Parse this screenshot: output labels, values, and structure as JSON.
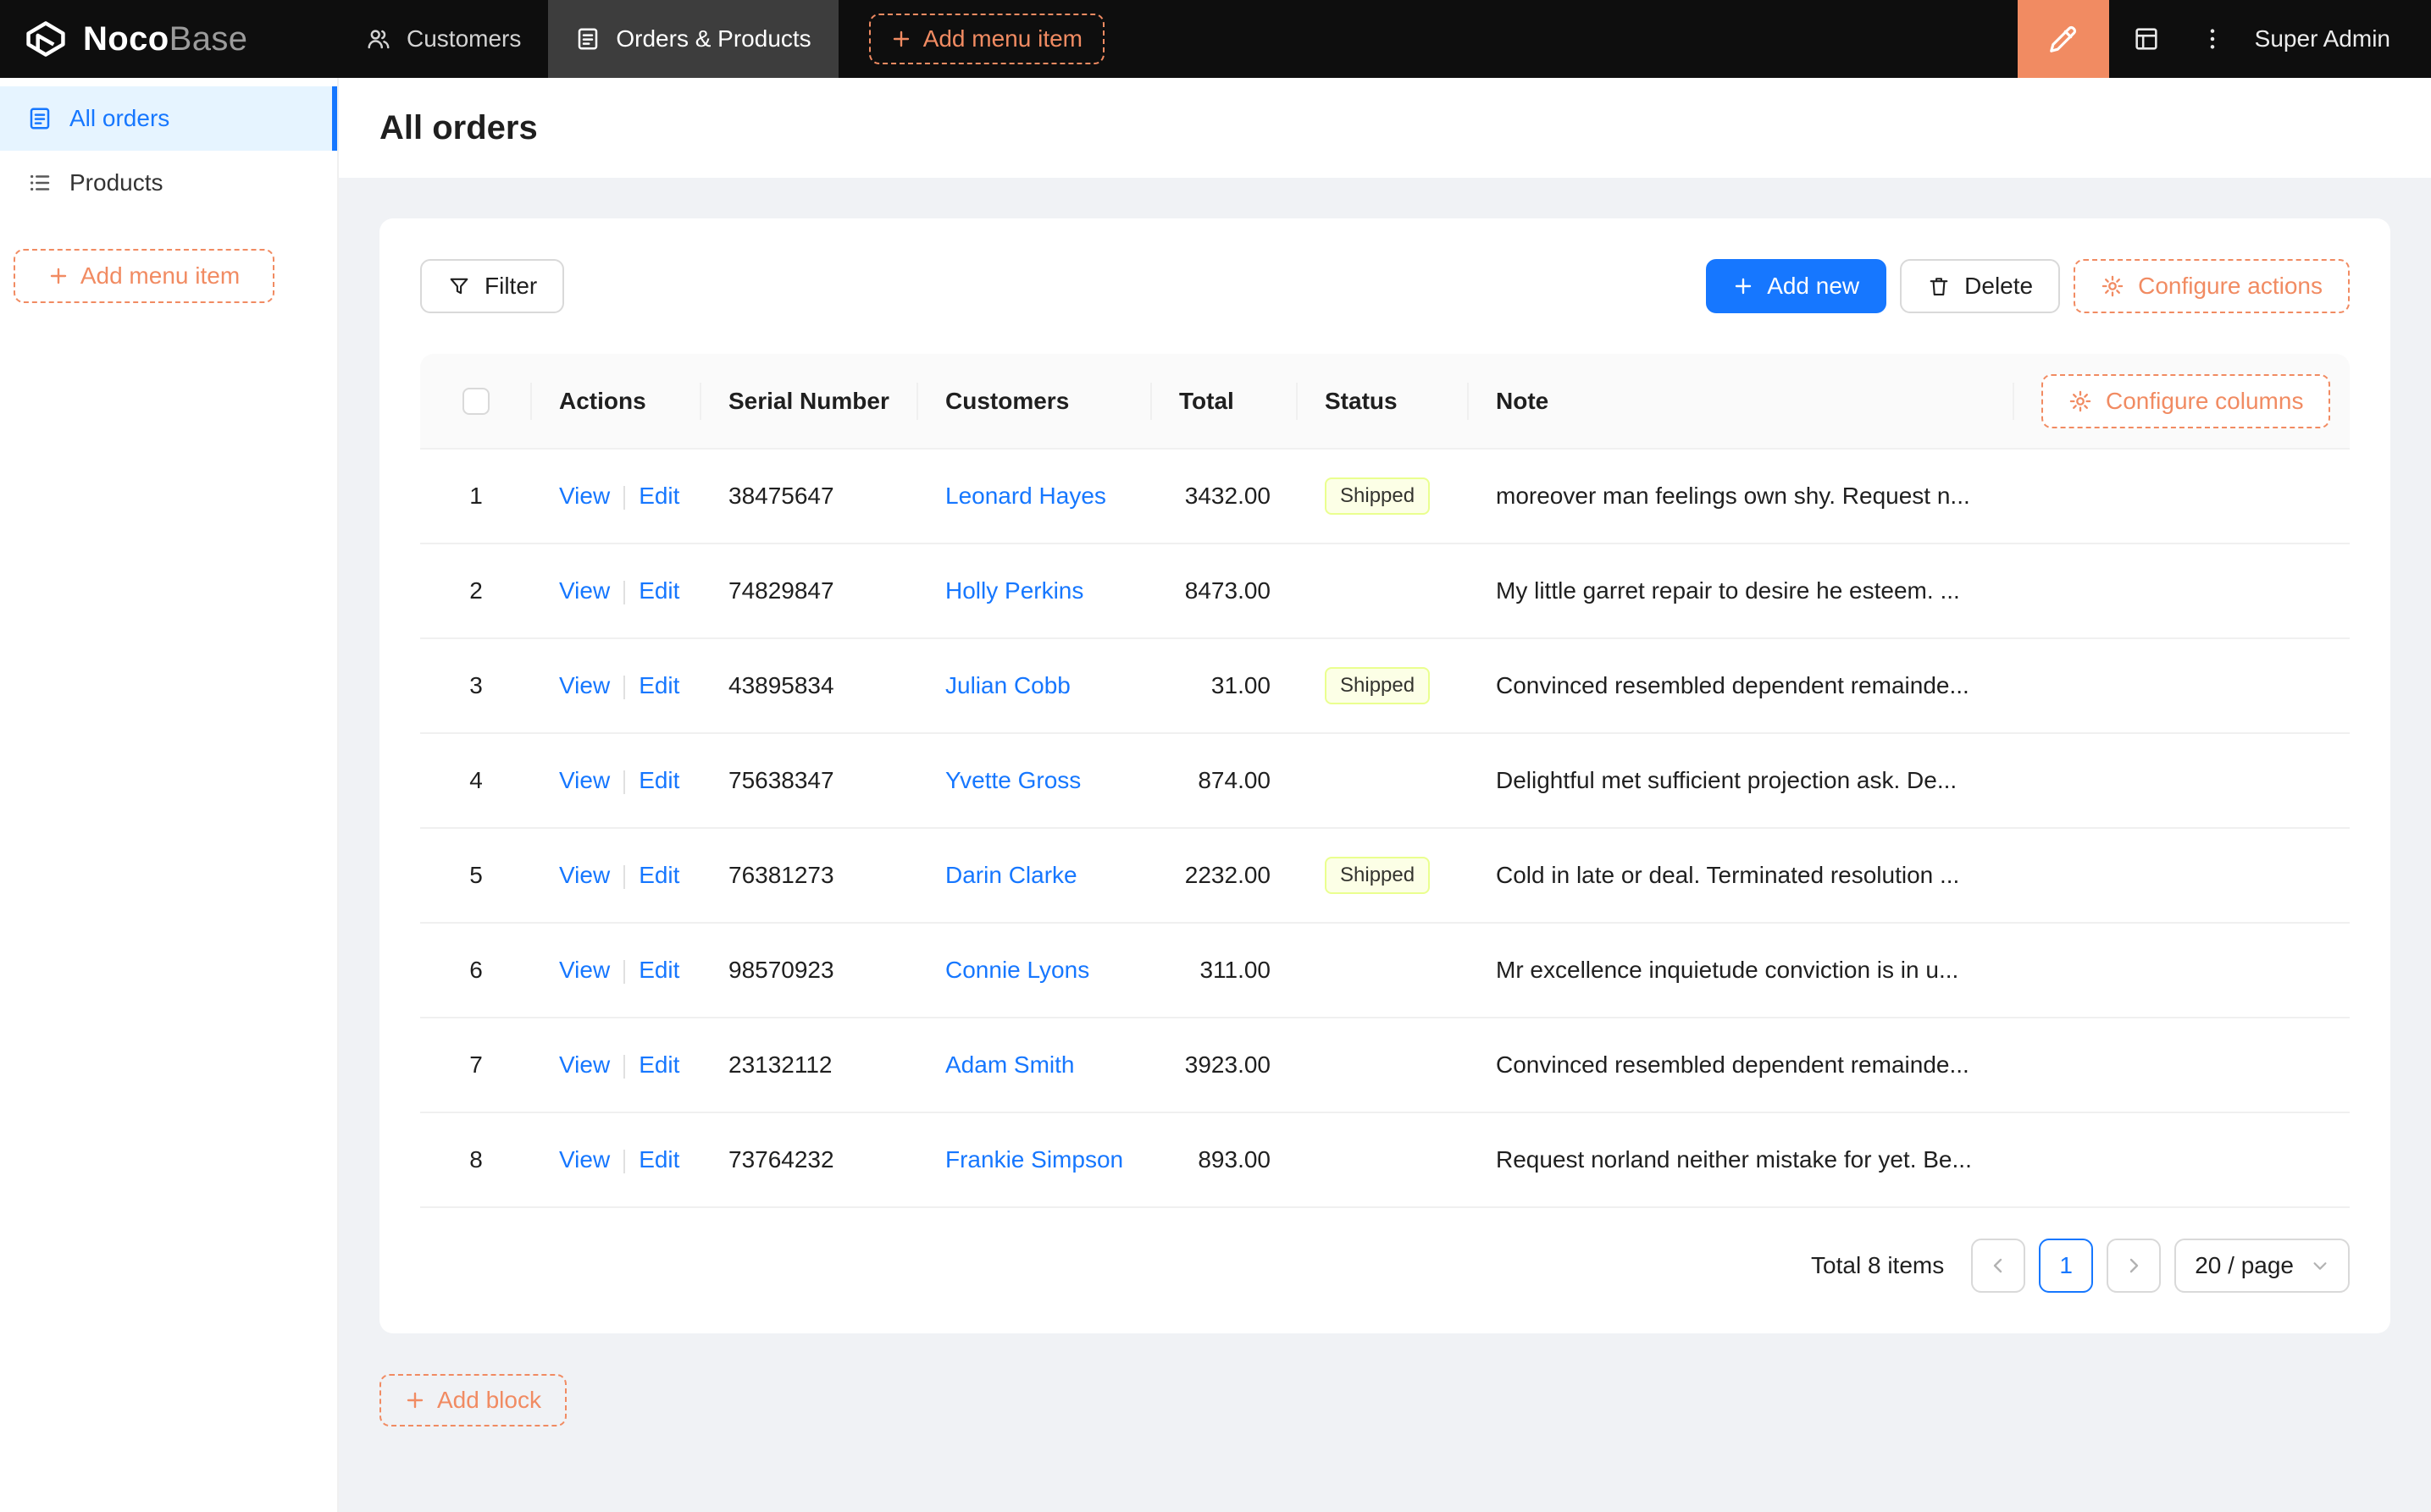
{
  "header": {
    "logo": {
      "bold": "Noco",
      "light": "Base"
    },
    "menu": [
      {
        "label": "Customers",
        "icon": "users-icon",
        "active": false
      },
      {
        "label": "Orders & Products",
        "icon": "orders-form-icon",
        "active": true
      }
    ],
    "add_menu_item": "Add menu item",
    "user": "Super Admin"
  },
  "sidebar": {
    "items": [
      {
        "label": "All orders",
        "icon": "orders-form-icon",
        "active": true
      },
      {
        "label": "Products",
        "icon": "list-icon",
        "active": false
      }
    ],
    "add_menu_item": "Add menu item"
  },
  "page": {
    "title": "All orders"
  },
  "toolbar": {
    "filter": "Filter",
    "add_new": "Add new",
    "delete": "Delete",
    "configure_actions": "Configure actions"
  },
  "table": {
    "configure_columns": "Configure columns",
    "columns": [
      "Actions",
      "Serial Number",
      "Customers",
      "Total",
      "Status",
      "Note"
    ],
    "action_labels": {
      "view": "View",
      "edit": "Edit"
    },
    "rows": [
      {
        "index": "1",
        "serial": "38475647",
        "customer": "Leonard Hayes",
        "total": "3432.00",
        "status": "Shipped",
        "note": "moreover man feelings own shy. Request n..."
      },
      {
        "index": "2",
        "serial": "74829847",
        "customer": "Holly Perkins",
        "total": "8473.00",
        "status": "",
        "note": "My little garret repair to desire he esteem. ..."
      },
      {
        "index": "3",
        "serial": "43895834",
        "customer": "Julian Cobb",
        "total": "31.00",
        "status": "Shipped",
        "note": "Convinced resembled dependent remainde..."
      },
      {
        "index": "4",
        "serial": "75638347",
        "customer": "Yvette Gross",
        "total": "874.00",
        "status": "",
        "note": "Delightful met sufficient projection ask. De..."
      },
      {
        "index": "5",
        "serial": "76381273",
        "customer": "Darin Clarke",
        "total": "2232.00",
        "status": "Shipped",
        "note": "Cold in late or deal. Terminated resolution ..."
      },
      {
        "index": "6",
        "serial": "98570923",
        "customer": "Connie Lyons",
        "total": "311.00",
        "status": "",
        "note": "Mr excellence inquietude conviction is in u..."
      },
      {
        "index": "7",
        "serial": "23132112",
        "customer": "Adam Smith",
        "total": "3923.00",
        "status": "",
        "note": "Convinced resembled dependent remainde..."
      },
      {
        "index": "8",
        "serial": "73764232",
        "customer": "Frankie Simpson",
        "total": "893.00",
        "status": "",
        "note": "Request norland neither mistake for yet. Be..."
      }
    ]
  },
  "pagination": {
    "total": "Total 8 items",
    "page": "1",
    "page_size": "20 / page"
  },
  "add_block": "Add block",
  "icons": {
    "nocobase-logo-icon": "hex-box outline",
    "users-icon": "two-person outline",
    "orders-form-icon": "clipboard with lines",
    "list-icon": "bulleted list",
    "plus-icon": "+",
    "filter-icon": "funnel",
    "trash-icon": "trash can",
    "gear-icon": "gear",
    "pen-icon": "highlighter pen",
    "table-icon": "table grid",
    "ellipsis-icon": "vertical dots",
    "chevron-left-icon": "<",
    "chevron-right-icon": ">",
    "chevron-down-icon": "v"
  },
  "colors": {
    "primary": "#1677ff",
    "orange": "#f18b62",
    "header_bg": "#0e0e0e",
    "header_active": "#3d3d3d",
    "sidebar_active_bg": "#e6f4ff",
    "content_bg": "#f0f2f5",
    "table_header_bg": "#fafafa",
    "tag_bg": "#fcffe6",
    "tag_border": "#eaff8f",
    "btn_border": "#d9d9d9"
  }
}
